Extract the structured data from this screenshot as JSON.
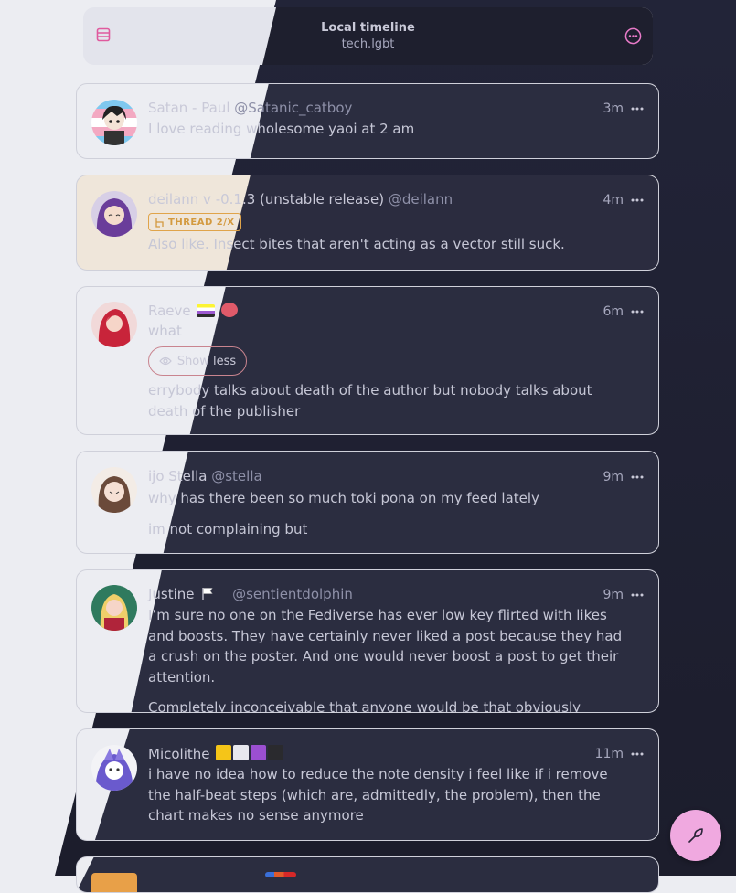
{
  "header": {
    "title": "Local timeline",
    "subtitle": "tech.lgbt",
    "menu_icon": "timeline-list-icon",
    "more_icon": "more-circle-icon"
  },
  "posts": [
    {
      "name": "Satan - Paul",
      "handle": "@Satanic_catboy",
      "time": "3m",
      "paragraphs": [
        "I love reading wholesome yaoi at 2 am"
      ]
    },
    {
      "name": "deilann v -0.1.3 (unstable release)",
      "handle": "@deilann",
      "time": "4m",
      "badge": "THREAD 2/X",
      "paragraphs": [
        "Also like. Insect bites that aren't acting as a vector still suck."
      ]
    },
    {
      "name": "Raeve",
      "handle": "",
      "time": "6m",
      "cw": "what",
      "show_less": "Show less",
      "paragraphs": [
        "errybody talks about death of the author but nobody talks about death of the publisher"
      ]
    },
    {
      "name": "ijo Stella",
      "handle": "@stella",
      "time": "9m",
      "paragraphs": [
        "why has there been so much toki pona on my feed lately",
        "im not complaining but"
      ]
    },
    {
      "name": "Justine",
      "handle": "@sentientdolphin",
      "time": "9m",
      "paragraphs": [
        "I’m sure no one on the Fediverse has ever low key flirted with likes and boosts. They have certainly never liked a post because they had a crush on the poster. And one would never boost a post to get their attention.",
        "Completely inconceivable that anyone would be that obviously subtle."
      ]
    },
    {
      "name": "Micolithe",
      "handle": "",
      "time": "11m",
      "paragraphs": [
        "i have no idea how to reduce the note density i feel like if i remove the half-beat steps (which are, admittedly, the problem), then the chart makes no sense anymore"
      ]
    }
  ],
  "colors": {
    "accent": "#f0a9e0",
    "thread_badge": "#d39a40",
    "dark_bg": "#222438",
    "light_bg": "#ecedf2"
  },
  "compose_icon": "feather-pen-icon"
}
